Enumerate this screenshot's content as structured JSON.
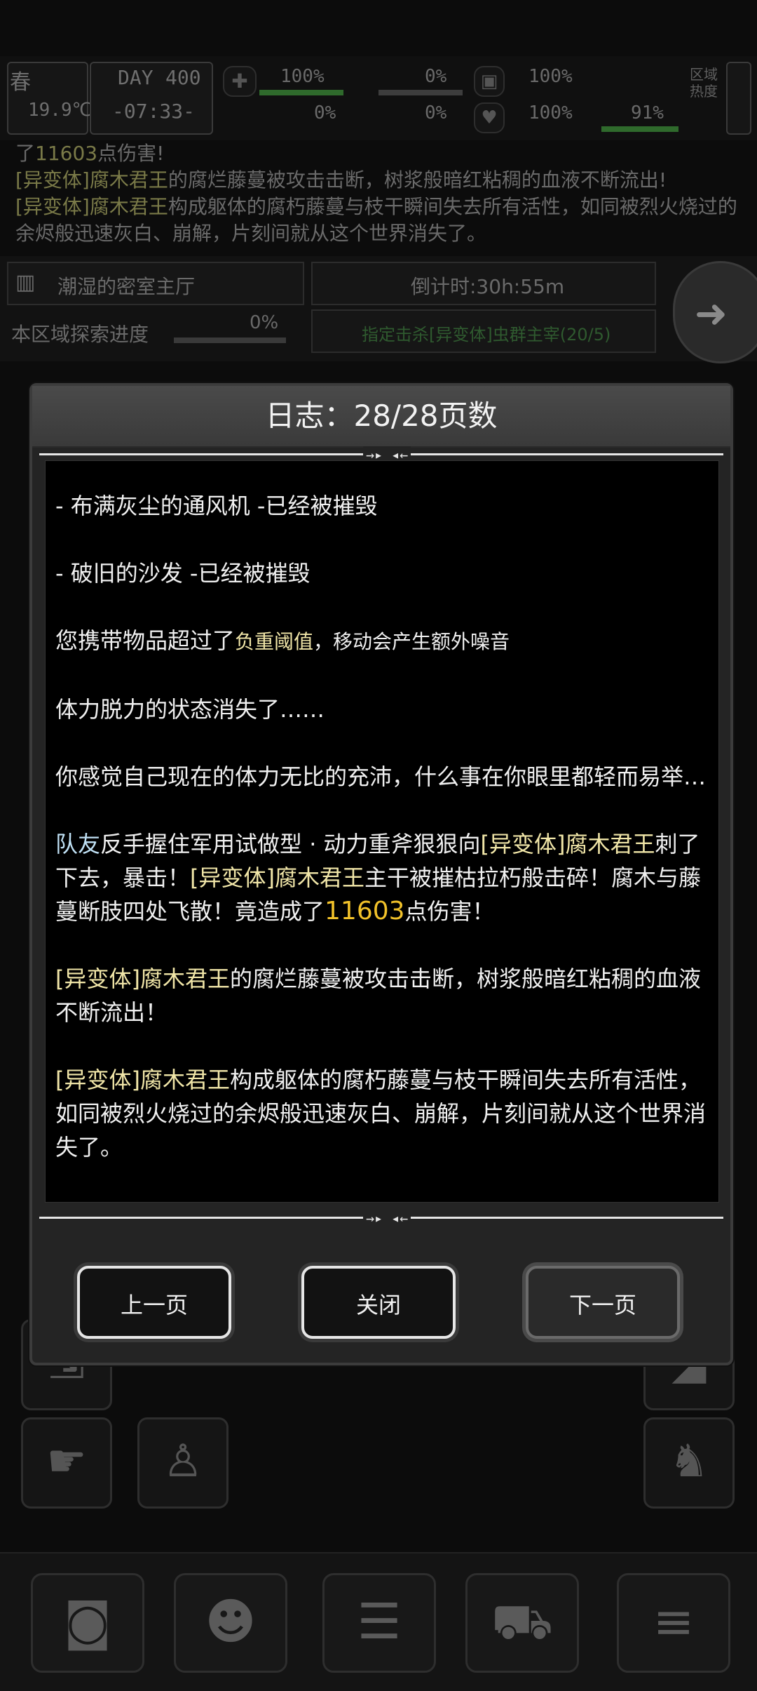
{
  "hud": {
    "season": "春",
    "temperature": "19.9℃",
    "day_label": "DAY",
    "day_number": "400",
    "clock": "-07:33-",
    "health_pct": "100%",
    "hunger_pct": "0%",
    "thirst_pct": "0%",
    "bleed_pct": "0%",
    "armor_pct": "100%",
    "heart_pct": "100%",
    "stamina_pct": "91%",
    "stat_pct_a": "0%",
    "region_label": "区域热度"
  },
  "background_log": {
    "line1_prefix": "了",
    "line1_num": "11603",
    "line1_suffix": "点伤害!",
    "line2_tag": "[异变体]腐木君王",
    "line2_text": "的腐烂藤蔓被攻击击断，树浆般暗红粘稠的血液不断流出!",
    "line3_tag": "[异变体]腐木君王",
    "line3_text": "构成躯体的腐朽藤蔓与枝干瞬间失去所有活性，如同被烈火烧过的余烬般迅速灰白、崩解，片刻间就从这个世界消失了。"
  },
  "zone": {
    "name": "潮湿的密室主厅",
    "countdown": "倒计时:30h:55m",
    "explore_label": "本区域探索进度",
    "explore_pct": "0%",
    "task": "指定击杀[异变体]虫群主宰(20/5)"
  },
  "modal": {
    "title": "日志：28/28页数",
    "log": {
      "e1": "- 布满灰尘的通风机 -已经被摧毁",
      "e2": "- 破旧的沙发 -已经被摧毁",
      "e3_a": "您携带物品超过了",
      "e3_b": "负重阈值",
      "e3_c": "，移动会产生额外噪音",
      "e4": "体力脱力的状态消失了……",
      "e5": "你感觉自己现在的体力无比的充沛，什么事在你眼里都轻而易举…",
      "e6_teammate": "队友",
      "e6_a": "反手握住军用试做型 · 动力重斧狠狠向",
      "e6_tag1": "[异变体]腐木君王",
      "e6_b": "刺了下去，暴击！",
      "e6_tag2": "[异变体]腐木君王",
      "e6_c": "主干被摧枯拉朽般击碎！腐木与藤蔓断肢四处飞散！竟造成了",
      "e6_dmg": "11603",
      "e6_d": "点伤害！",
      "e7_tag": "[异变体]腐木君王",
      "e7_text": "的腐烂藤蔓被攻击击断，树浆般暗红粘稠的血液不断流出！",
      "e8_tag": "[异变体]腐木君王",
      "e8_text": "构成躯体的腐朽藤蔓与枝干瞬间失去所有活性，如同被烈火烧过的余烬般迅速灰白、崩解，片刻间就从这个世界消失了。"
    },
    "buttons": {
      "prev": "上一页",
      "close": "关闭",
      "next": "下一页"
    }
  },
  "colors": {
    "highlight_tag": "#f1e6a8",
    "teammate": "#bfe0f4",
    "damage": "#f2c22a"
  }
}
